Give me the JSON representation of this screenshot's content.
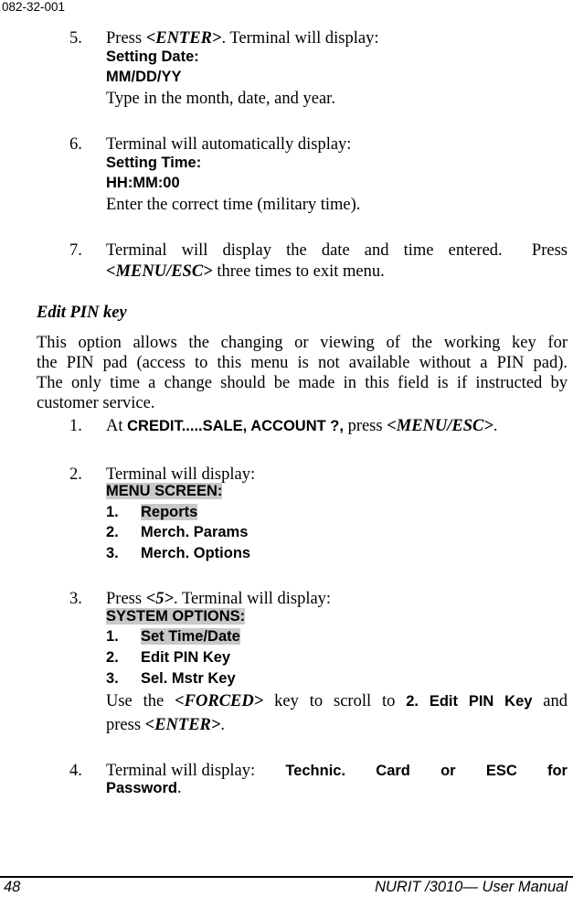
{
  "header": {
    "doc_id": "082-32-001"
  },
  "steps_a": [
    {
      "number": "5.",
      "pre": "Press ",
      "key": "<ENTER>",
      "post": ". Terminal will display:",
      "display": [
        "Setting Date:",
        "MM/DD/YY"
      ],
      "instruction": "Type in the month, date, and year."
    },
    {
      "number": "6.",
      "text": "Terminal will automatically display:",
      "display": [
        "Setting Time:",
        "HH:MM:00"
      ],
      "instruction": "Enter the correct time (military time)."
    },
    {
      "number": "7.",
      "line1": "Terminal will display the date and time entered.  Press",
      "key": "<MENU/ESC>",
      "line2_post": " three times to exit menu."
    }
  ],
  "section": {
    "heading": "Edit PIN key",
    "paragraph_lines": [
      "This option allows the changing or viewing of the working key for",
      "the PIN pad (access to this menu is not available without a PIN pad).",
      "The only time a change should be made in this field is if instructed by",
      "customer service."
    ]
  },
  "steps_b": [
    {
      "number": "1.",
      "pre": "At ",
      "display": "CREDIT.....SALE, ACCOUNT ?,",
      "mid": " press ",
      "key": "<MENU/ESC>",
      "post": "."
    },
    {
      "number": "2.",
      "text": "Terminal will display:",
      "menu_title": "MENU SCREEN:",
      "menu_items": [
        {
          "num": "1.",
          "label": "Reports"
        },
        {
          "num": "2.",
          "label": "Merch. Params"
        },
        {
          "num": "3.",
          "label": "Merch. Options"
        }
      ]
    },
    {
      "number": "3.",
      "pre": "Press ",
      "key": "<5>",
      "post": ". Terminal will display:",
      "menu_title": "SYSTEM OPTIONS:",
      "menu_items": [
        {
          "num": "1.",
          "label": "Set Time/Date"
        },
        {
          "num": "2.",
          "label": "Edit PIN Key"
        },
        {
          "num": "3.",
          "label": "Sel. Mstr Key"
        }
      ],
      "use_pre": "Use the ",
      "use_key": "<FORCED>",
      "use_mid": " key to scroll to ",
      "use_target": "2. Edit PIN Key",
      "use_post": " and",
      "press_pre": "press ",
      "press_key": "<ENTER>",
      "press_post": "."
    },
    {
      "number": "4.",
      "line1_text": "Terminal will display:",
      "line1_display_words": [
        "Technic.",
        "Card",
        "or",
        "ESC",
        "for"
      ],
      "line2_display": "Password",
      "line2_post": "."
    }
  ],
  "footer": {
    "page_number": "48",
    "manual_title": "NURIT /3010— User Manual"
  },
  "colors": {
    "highlight": "#c8c8c8",
    "text": "#000000"
  }
}
